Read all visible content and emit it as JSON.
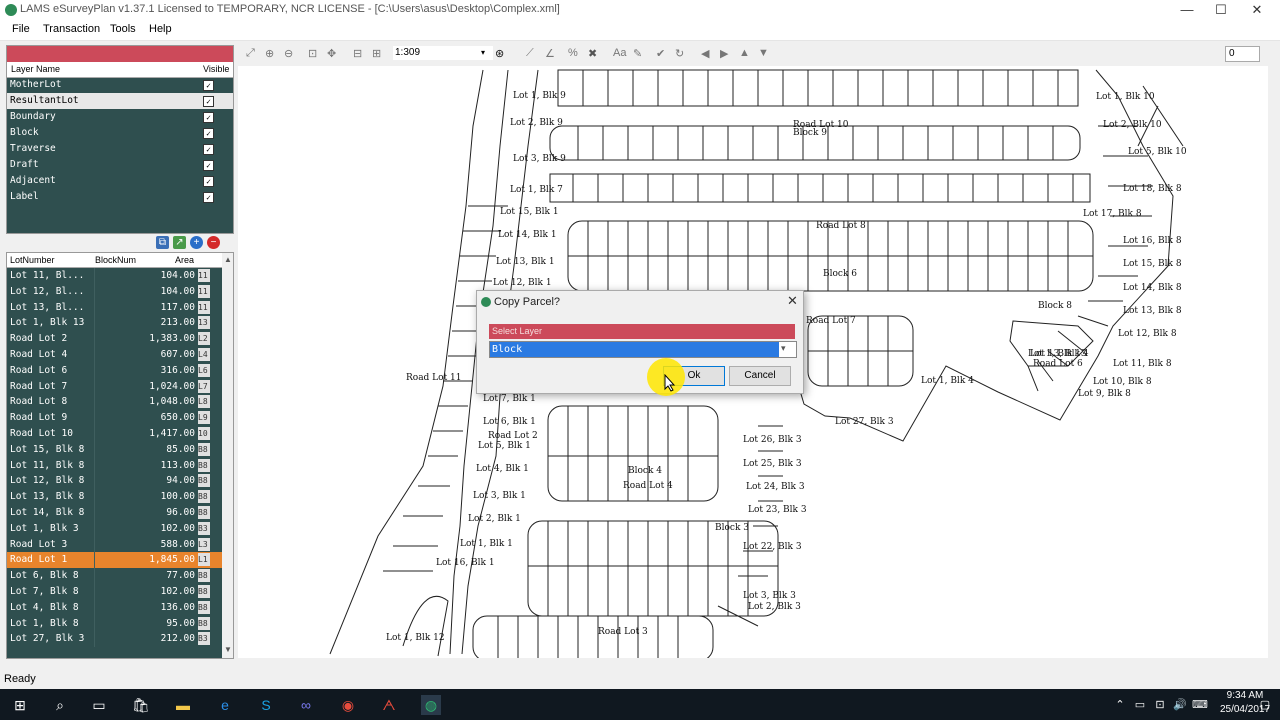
{
  "window": {
    "title": "LAMS eSurveyPlan v1.37.1 Licensed to TEMPORARY, NCR LICENSE - [C:\\Users\\asus\\Desktop\\Complex.xml]",
    "min": "—",
    "max": "☐",
    "close": "✕"
  },
  "menu": [
    "File",
    "Transaction",
    "Tools",
    "Help"
  ],
  "layers": {
    "headers": [
      "Layer Name",
      "Visible"
    ],
    "items": [
      {
        "name": "MotherLot",
        "visible": true
      },
      {
        "name": "ResultantLot",
        "visible": true
      },
      {
        "name": "Boundary",
        "visible": true
      },
      {
        "name": "Block",
        "visible": true
      },
      {
        "name": "Traverse",
        "visible": true
      },
      {
        "name": "Draft",
        "visible": true
      },
      {
        "name": "Adjacent",
        "visible": true
      },
      {
        "name": "Label",
        "visible": true
      }
    ]
  },
  "lots": {
    "headers": [
      "LotNumber",
      "BlockNum",
      "Area"
    ],
    "rows": [
      {
        "lot": "Lot 11, Bl...",
        "area": "104.00",
        "tag": "11"
      },
      {
        "lot": "Lot 12, Bl...",
        "area": "104.00",
        "tag": "11"
      },
      {
        "lot": "Lot 13, Bl...",
        "area": "117.00",
        "tag": "11"
      },
      {
        "lot": "Lot 1, Blk 13",
        "area": "213.00",
        "tag": "13"
      },
      {
        "lot": "Road Lot 2",
        "area": "1,383.00",
        "tag": "L2"
      },
      {
        "lot": "Road Lot 4",
        "area": "607.00",
        "tag": "L4"
      },
      {
        "lot": "Road Lot 6",
        "area": "316.00",
        "tag": "L6"
      },
      {
        "lot": "Road Lot 7",
        "area": "1,024.00",
        "tag": "L7"
      },
      {
        "lot": "Road Lot 8",
        "area": "1,048.00",
        "tag": "L8"
      },
      {
        "lot": "Road Lot 9",
        "area": "650.00",
        "tag": "L9"
      },
      {
        "lot": "Road Lot 10",
        "area": "1,417.00",
        "tag": "10"
      },
      {
        "lot": "Lot 15, Blk 8",
        "area": "85.00",
        "tag": "B8"
      },
      {
        "lot": "Lot 11, Blk 8",
        "area": "113.00",
        "tag": "B8"
      },
      {
        "lot": "Lot 12, Blk 8",
        "area": "94.00",
        "tag": "B8"
      },
      {
        "lot": "Lot 13, Blk 8",
        "area": "100.00",
        "tag": "B8"
      },
      {
        "lot": "Lot 14, Blk 8",
        "area": "96.00",
        "tag": "B8"
      },
      {
        "lot": "Lot 1, Blk 3",
        "area": "102.00",
        "tag": "B3"
      },
      {
        "lot": "Road Lot 3",
        "area": "588.00",
        "tag": "L3"
      },
      {
        "lot": "Road Lot 1",
        "area": "1,845.00",
        "tag": "L1"
      },
      {
        "lot": "Lot 6, Blk 8",
        "area": "77.00",
        "tag": "B8"
      },
      {
        "lot": "Lot 7, Blk 8",
        "area": "102.00",
        "tag": "B8"
      },
      {
        "lot": "Lot 4, Blk 8",
        "area": "136.00",
        "tag": "B8"
      },
      {
        "lot": "Lot 1, Blk 8",
        "area": "95.00",
        "tag": "B8"
      },
      {
        "lot": "Lot 27, Blk 3",
        "area": "212.00",
        "tag": "B3"
      }
    ]
  },
  "toolbar": {
    "scale": "1:309",
    "number": "0"
  },
  "map_labels": [
    "Lot 1, Blk 9",
    "Lot 2, Blk 9",
    "Lot 3, Blk 9",
    "Lot 1, Blk 7",
    "Lot 15, Blk 1",
    "Lot 14, Blk 1",
    "Lot 13, Blk 1",
    "Lot 12, Blk 1",
    "Road Lot 10",
    "Block 9",
    "Road Lot 8",
    "Block 6",
    "Block 8",
    "Road Lot 7",
    "Road Lot 11",
    "Lot 1, Blk 10",
    "Lot 2, Blk 10",
    "Lot 5, Blk 10",
    "Lot 17, Blk 8",
    "Lot 18, Blk 8",
    "Lot 16, Blk 8",
    "Lot 15, Blk 8",
    "Lot 14, Blk 8",
    "Lot 13, Blk 8",
    "Lot 12, Blk 8",
    "Lot 11, Blk 8",
    "Lot 10, Blk 8",
    "Lot 9, Blk 8",
    "Road Lot 6",
    "Lot 1, Blk 13",
    "Lot 27, Blk 3",
    "Lot 26, Blk 3",
    "Lot 25, Blk 3",
    "Lot 24, Blk 3",
    "Lot 23, Blk 3",
    "Block 3",
    "Lot 22, Blk 3",
    "Lot 3, Blk 3",
    "Lot 2, Blk 3",
    "Block 4",
    "Road Lot 4",
    "Road Lot 2",
    "Road Lot 3",
    "Lot 1, Blk 12",
    "Lot 16, Blk 1",
    "Lot 7, Blk 1",
    "Lot 6, Blk 1",
    "Lot 5, Blk 1",
    "Lot 4, Blk 1",
    "Lot 3, Blk 1",
    "Lot 2, Blk 1",
    "Lot 1, Blk 1",
    "Lot 1, Blk 4",
    "Lot 13, Blk 4"
  ],
  "dialog": {
    "title": "Copy Parcel?",
    "label": "Select Layer",
    "selected": "Block",
    "ok": "Ok",
    "cancel": "Cancel"
  },
  "status": "Ready",
  "taskbar": {
    "time": "9:34 AM",
    "date": "25/04/2017"
  }
}
